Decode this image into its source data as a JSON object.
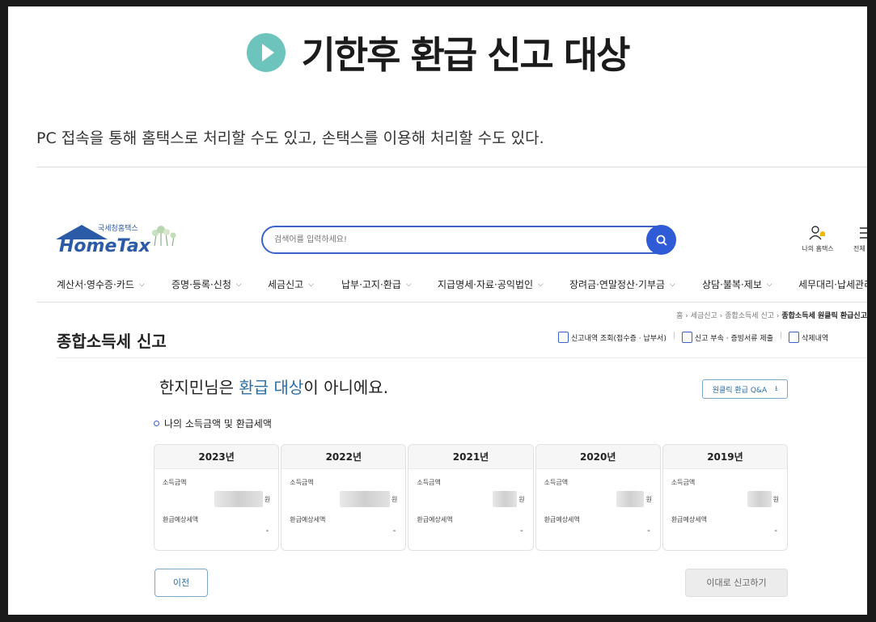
{
  "hero": {
    "title": "기한후 환급 신고 대상"
  },
  "intro": "PC 접속을 통해 홈택스로 처리할 수도 있고, 손택스를 이용해 처리할 수도 있다.",
  "hometax": {
    "logo_sub": "국세청홈택스",
    "logo_main": "HomeTax",
    "search_placeholder": "검색어를 입력하세요!",
    "my_hometax": "나의 홈택스",
    "menu_all": "전체",
    "gnb": [
      "계산서·영수증·카드",
      "증명·등록·신청",
      "세금신고",
      "납부·고지·환급",
      "지급명세·자료·공익법인",
      "장려금·연말정산·기부금",
      "상담·불복·제보",
      "세무대리·납세관리"
    ],
    "breadcrumb": {
      "home": "홈",
      "l1": "세금신고",
      "l2": "종합소득세 신고",
      "current": "종합소득세 원클릭 환급신고"
    },
    "page_title": "종합소득세 신고",
    "actions": [
      "신고내역 조회(접수증 · 납부서)",
      "신고 부속 · 증빙서류 제출",
      "삭제내역"
    ],
    "notice": {
      "name": "한지민",
      "p1": "님은 ",
      "highlight": "환급 대상",
      "p2": "이 아니에요."
    },
    "qa_button": "원클릭 환급 Q&A",
    "section_title": "나의 소득금액 및 환급세액",
    "income_label": "소득금액",
    "refund_label": "환급예상세액",
    "years": [
      {
        "year": "2023년",
        "unit": "원",
        "refund": "-"
      },
      {
        "year": "2022년",
        "unit": "원",
        "refund": "-"
      },
      {
        "year": "2021년",
        "unit": "원",
        "refund": "-"
      },
      {
        "year": "2020년",
        "unit": "원",
        "refund": "-"
      },
      {
        "year": "2019년",
        "unit": "원",
        "refund": "-"
      }
    ],
    "prev_button": "이전",
    "report_button": "이대로 신고하기"
  }
}
